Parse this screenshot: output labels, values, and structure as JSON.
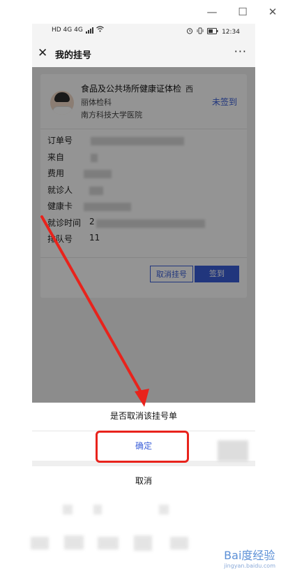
{
  "window": {
    "minimize_glyph": "—",
    "maximize_glyph": "☐",
    "close_glyph": "✕"
  },
  "statusbar": {
    "left_text": "HD 4G 4G",
    "time": "12:34"
  },
  "header": {
    "title": "我的挂号",
    "more": "···"
  },
  "card": {
    "title": "食品及公共场所健康证体检",
    "title_suffix": "西",
    "dept": "丽体检科",
    "hospital": "南方科技大学医院",
    "status": "未签到",
    "fields": [
      {
        "label": "订单号",
        "value": ""
      },
      {
        "label": "来自",
        "value": ""
      },
      {
        "label": "费用",
        "value": ""
      },
      {
        "label": "就诊人",
        "value": ""
      },
      {
        "label": "健康卡",
        "value": ""
      },
      {
        "label": "就诊时间",
        "value": "2"
      },
      {
        "label": "排队号",
        "value": "11"
      }
    ],
    "cancel_button": "取消挂号",
    "checkin_button": "签到"
  },
  "sheet": {
    "title": "是否取消该挂号单",
    "confirm": "确定",
    "cancel": "取消"
  },
  "watermark": {
    "text": "Bai度经验",
    "sub": "jingyan.baidu.com"
  },
  "colors": {
    "accent": "#3a5ed8",
    "annotation": "#e8231c"
  }
}
